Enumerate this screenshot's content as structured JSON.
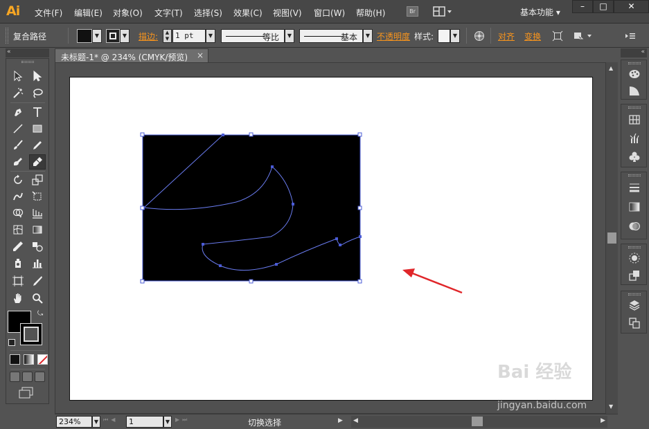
{
  "app": {
    "logo": "Ai",
    "workspace": "基本功能 ▾",
    "bridge_label": "Br"
  },
  "menu": [
    "文件(F)",
    "编辑(E)",
    "对象(O)",
    "文字(T)",
    "选择(S)",
    "效果(C)",
    "视图(V)",
    "窗口(W)",
    "帮助(H)"
  ],
  "window_controls": {
    "minimize": "–",
    "maximize": "□",
    "close": "✕"
  },
  "control_bar": {
    "selection_type": "复合路径",
    "stroke_label": "描边:",
    "stroke_weight": "1 pt",
    "profile_label": "等比",
    "brush_label": "基本",
    "opacity_label": "不透明度",
    "style_label": "样式:",
    "align_label": "对齐",
    "transform_label": "变换"
  },
  "document": {
    "tab_title": "未标题-1* @ 234% (CMYK/预览)",
    "close": "×"
  },
  "status_bar": {
    "zoom": "234%",
    "page": "1",
    "status_text": "切换选择"
  },
  "colors": {
    "accent_orange": "#f7941d",
    "path_blue": "#4a5bd6",
    "arrow_red": "#e0262a",
    "fill": "#000000"
  },
  "tools": [
    "selection-tool",
    "direct-selection-tool",
    "magic-wand-tool",
    "lasso-tool",
    "pen-tool",
    "type-tool",
    "line-segment-tool",
    "rectangle-tool",
    "paintbrush-tool",
    "pencil-tool",
    "blob-brush-tool",
    "eraser-tool",
    "rotate-tool",
    "scale-tool",
    "warp-tool",
    "free-transform-tool",
    "shape-builder-tool",
    "perspective-grid-tool",
    "mesh-tool",
    "gradient-tool",
    "eyedropper-tool",
    "blend-tool",
    "symbol-sprayer-tool",
    "column-graph-tool",
    "artboard-tool",
    "slice-tool",
    "hand-tool",
    "zoom-tool"
  ],
  "watermark": {
    "brand": "Bai 经验",
    "url": "jingyan.baidu.com"
  }
}
